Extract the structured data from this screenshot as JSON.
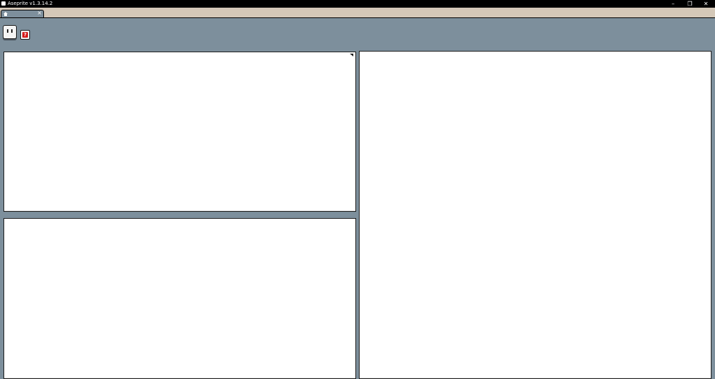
{
  "window": {
    "title": "Aseprite v1.3.14.2",
    "minimize_glyph": "–",
    "restore_glyph": "❐",
    "close_glyph": "✕"
  },
  "tabs": [
    {
      "icon": "home-icon",
      "close_glyph": "×",
      "active": true
    }
  ],
  "home": {
    "help_glyph": "?"
  },
  "colors": {
    "workspace": "#7d8f9c",
    "tabstrip": "#d4c8b8",
    "help_red": "#d41818"
  }
}
